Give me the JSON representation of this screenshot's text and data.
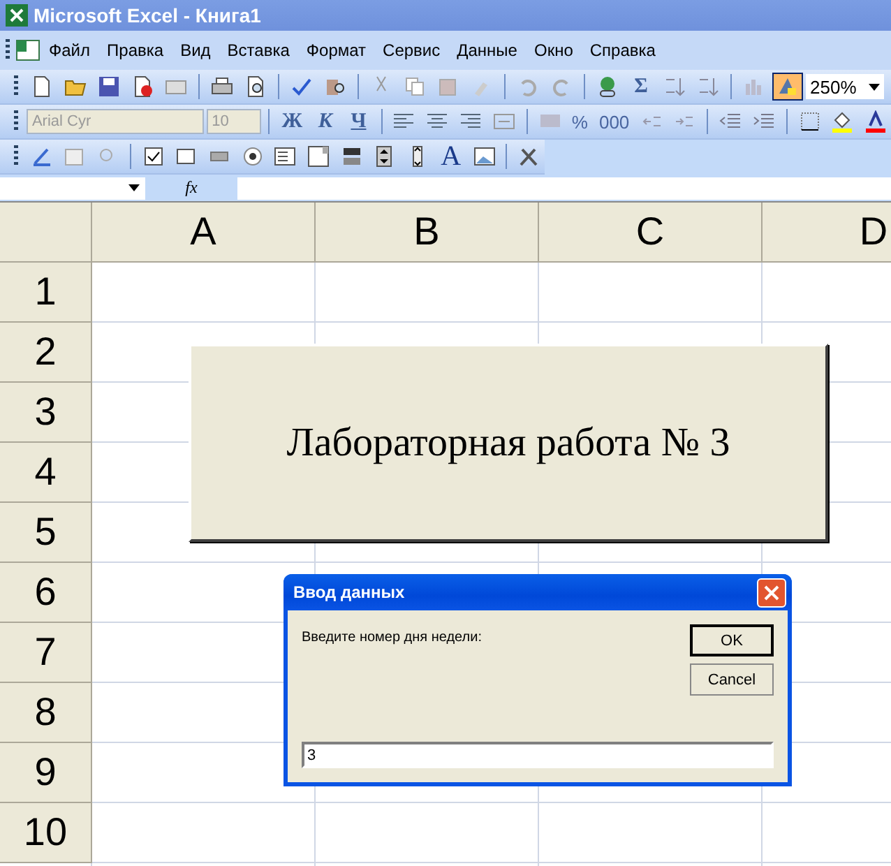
{
  "window": {
    "title": "Microsoft Excel - Книга1"
  },
  "menu": [
    "Файл",
    "Правка",
    "Вид",
    "Вставка",
    "Формат",
    "Сервис",
    "Данные",
    "Окно",
    "Справка"
  ],
  "standard_toolbar": {
    "sigma": "Σ",
    "drawing_toggle_on": true,
    "zoom": "250%"
  },
  "format_toolbar": {
    "font": "Arial Cyr",
    "size": "10",
    "bold": "Ж",
    "italic": "К",
    "underline": "Ч",
    "percent": "%",
    "thousands": "000"
  },
  "forms_toolbar": {
    "label_tool": "A"
  },
  "formula_bar": {
    "fx": "fx"
  },
  "sheet": {
    "columns": [
      "A",
      "B",
      "C",
      "D"
    ],
    "rows": [
      "1",
      "2",
      "3",
      "4",
      "5",
      "6",
      "7",
      "8",
      "9",
      "10"
    ]
  },
  "sheet_button": {
    "label": "Лабораторная работа № 3"
  },
  "dialog": {
    "title": "Ввод данных",
    "prompt": "Введите номер дня недели:",
    "buttons": [
      "OK",
      "Cancel"
    ],
    "value": "3"
  }
}
